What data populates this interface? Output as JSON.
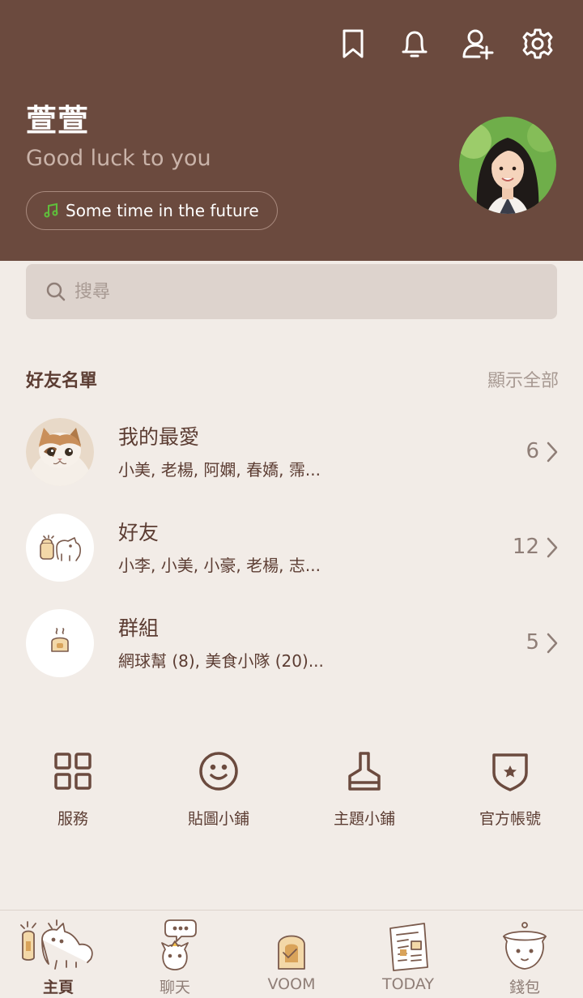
{
  "header": {
    "icons": [
      "bookmark-icon",
      "bell-icon",
      "add-friend-icon",
      "gear-icon"
    ],
    "profile": {
      "name": "萱萱",
      "status": "Good luck to you",
      "music": "Some time in the future"
    }
  },
  "search": {
    "placeholder": "搜尋"
  },
  "friends_section": {
    "title": "好友名單",
    "show_all": "顯示全部",
    "rows": [
      {
        "title": "我的最愛",
        "subtitle": "小美, 老楊, 阿嫻, 春嬌, 霈...",
        "count": "6",
        "icon": "cat-avatar"
      },
      {
        "title": "好友",
        "subtitle": "小李, 小美, 小豪, 老楊, 志...",
        "count": "12",
        "icon": "friends-avatar"
      },
      {
        "title": "群組",
        "subtitle": "網球幫 (8), 美食小隊 (20)...",
        "count": "5",
        "icon": "groups-avatar"
      }
    ]
  },
  "quick_actions": [
    {
      "label": "服務",
      "icon": "grid-icon"
    },
    {
      "label": "貼圖小鋪",
      "icon": "smiley-icon"
    },
    {
      "label": "主題小鋪",
      "icon": "brush-icon"
    },
    {
      "label": "官方帳號",
      "icon": "shield-star-icon"
    }
  ],
  "tabs": [
    {
      "label": "主頁",
      "icon": "home-icon",
      "active": true
    },
    {
      "label": "聊天",
      "icon": "chat-icon",
      "active": false
    },
    {
      "label": "VOOM",
      "icon": "voom-icon",
      "active": false
    },
    {
      "label": "TODAY",
      "icon": "news-icon",
      "active": false
    },
    {
      "label": "錢包",
      "icon": "wallet-icon",
      "active": false
    }
  ],
  "colors": {
    "header_bg": "#6b4a3e",
    "page_bg": "#f2ece7",
    "text_primary": "#5c3d33",
    "text_muted": "#a89a93",
    "music_accent": "#5fbf3b"
  }
}
